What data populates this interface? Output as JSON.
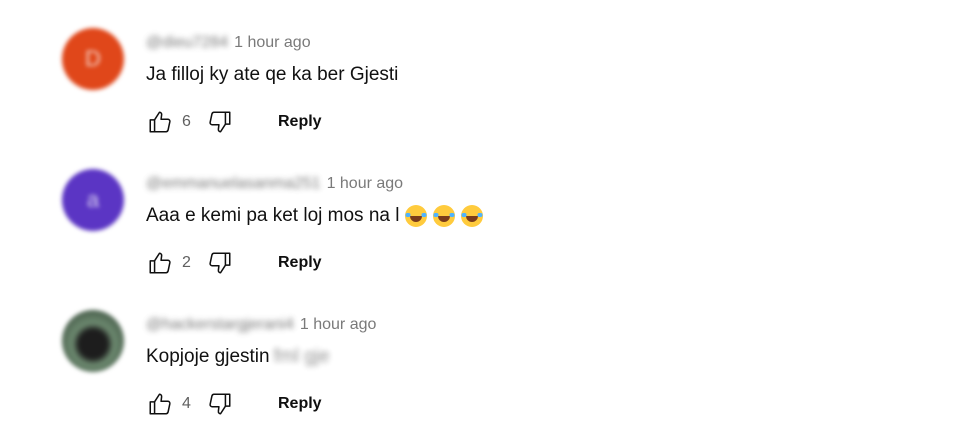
{
  "comments": [
    {
      "avatar_letter": "D",
      "avatar_color": "#e0471a",
      "handle": "@dieu7284",
      "time": "1 hour ago",
      "text": "Ja filloj ky ate qe ka ber Gjesti",
      "blurred_tail": "",
      "emoji_count": 0,
      "likes": "6",
      "reply_label": "Reply"
    },
    {
      "avatar_letter": "a",
      "avatar_color": "#5b35c4",
      "handle": "@emmanuelasanma251",
      "time": "1 hour ago",
      "text": "Aaa e kemi pa ket loj  mos na l",
      "blurred_tail": "",
      "emoji_count": 3,
      "likes": "2",
      "reply_label": "Reply"
    },
    {
      "avatar_letter": "",
      "avatar_color": "#3a4a3e",
      "handle": "@hackerstargjerani4",
      "time": "1 hour ago",
      "text": "Kopjoje gjestin",
      "blurred_tail": "fml gje",
      "emoji_count": 0,
      "likes": "4",
      "reply_label": "Reply"
    }
  ],
  "icons": {
    "like": "thumb-up-outline-icon",
    "dislike": "thumb-down-outline-icon",
    "emoji": "face-with-tears-of-joy-icon"
  }
}
